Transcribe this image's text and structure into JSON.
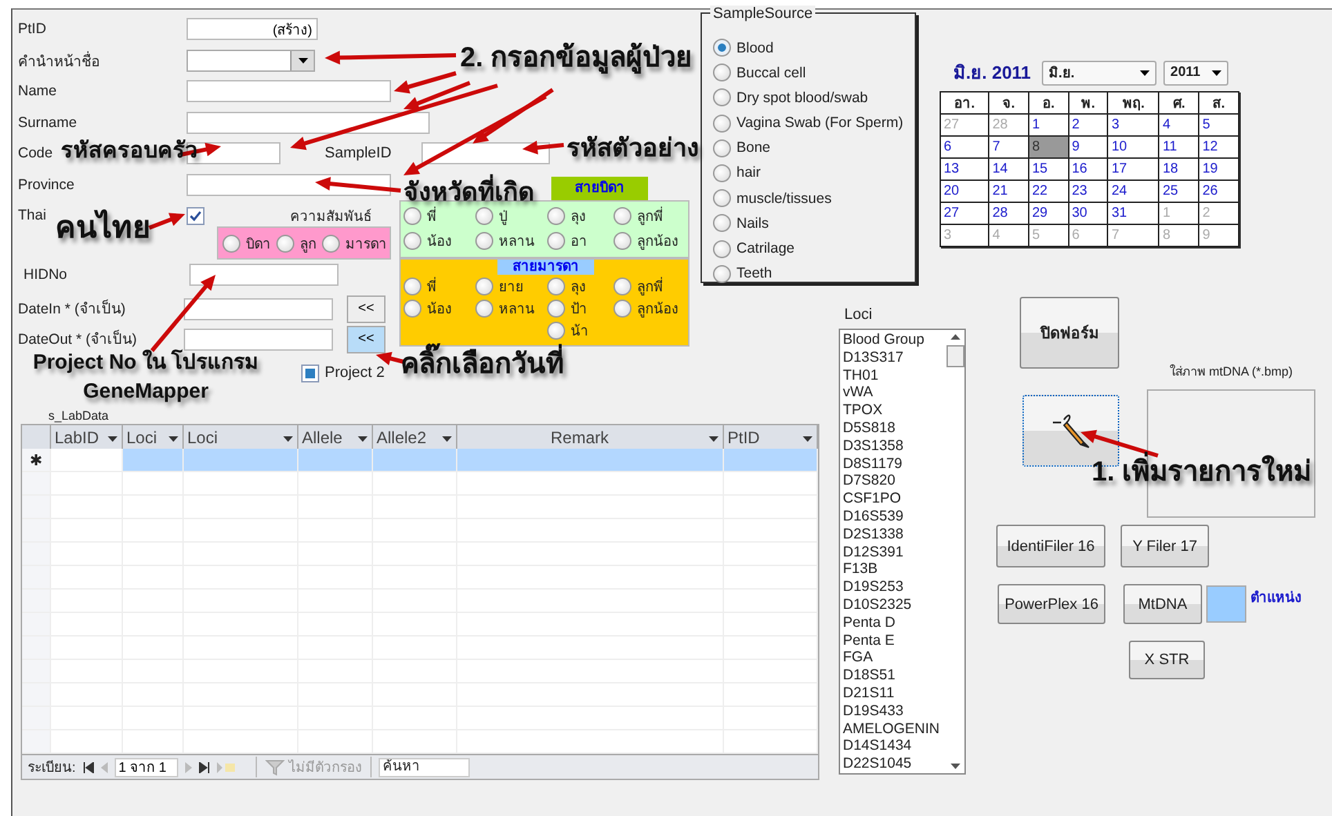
{
  "fields": {
    "ptid": {
      "label": "PtID",
      "value": "(สร้าง)"
    },
    "prefix": {
      "label": "คำนำหน้าชื่อ"
    },
    "name": {
      "label": "Name"
    },
    "surname": {
      "label": "Surname"
    },
    "code": {
      "label": "Code"
    },
    "sample_id": {
      "label": "SampleID"
    },
    "province": {
      "label": "Province"
    },
    "thai": {
      "label": "Thai",
      "checked": true
    },
    "hidno": {
      "label": "HIDNo"
    },
    "date_in": {
      "label": "DateIn * (จำเป็น)",
      "button": "<<"
    },
    "date_out": {
      "label": "DateOut * (จำเป็น)",
      "button": "<<"
    }
  },
  "relationship": {
    "label": "ความสัมพันธ์",
    "options": [
      {
        "label": "บิดา",
        "selected": false
      },
      {
        "label": "ลูก",
        "selected": false
      },
      {
        "label": "มารดา",
        "selected": false
      }
    ]
  },
  "father_line": {
    "title": "สายบิดา",
    "options": [
      {
        "label": "พี่",
        "selected": false
      },
      {
        "label": "ปู่",
        "selected": false
      },
      {
        "label": "ลุง",
        "selected": false
      },
      {
        "label": "ลูกพี่",
        "selected": false
      },
      {
        "label": "น้อง",
        "selected": false
      },
      {
        "label": "หลาน",
        "selected": false
      },
      {
        "label": "อา",
        "selected": false
      },
      {
        "label": "ลูกน้อง",
        "selected": false
      }
    ]
  },
  "mother_line": {
    "title": "สายมารดา",
    "options": [
      {
        "label": "พี่",
        "selected": false
      },
      {
        "label": "ยาย",
        "selected": false
      },
      {
        "label": "ลุง",
        "selected": false
      },
      {
        "label": "ลูกพี่",
        "selected": false
      },
      {
        "label": "น้อง",
        "selected": false
      },
      {
        "label": "หลาน",
        "selected": false
      },
      {
        "label": "ป้า",
        "selected": false
      },
      {
        "label": "ลูกน้อง",
        "selected": false
      },
      {
        "label": "น้า",
        "selected": false
      }
    ]
  },
  "project2": {
    "label": "Project 2",
    "checked": true
  },
  "subform": {
    "label": "s_LabData",
    "columns": [
      "LabID",
      "Loci",
      "Loci",
      "Allele",
      "Allele2",
      "Remark",
      "PtID"
    ],
    "new_row_marker": "✱",
    "navigation": {
      "label": "ระเบียน:",
      "position": "1 จาก 1",
      "filter": "ไม่มีตัวกรอง",
      "search_placeholder": "ค้นหา"
    }
  },
  "sample_source": {
    "title": "SampleSource",
    "options": [
      {
        "label": "Blood",
        "selected": true
      },
      {
        "label": "Buccal cell",
        "selected": false
      },
      {
        "label": "Dry spot blood/swab",
        "selected": false
      },
      {
        "label": "Vagina Swab (For Sperm)",
        "selected": false
      },
      {
        "label": "Bone",
        "selected": false
      },
      {
        "label": "hair",
        "selected": false
      },
      {
        "label": "muscle/tissues",
        "selected": false
      },
      {
        "label": "Nails",
        "selected": false
      },
      {
        "label": "Catrilage",
        "selected": false
      },
      {
        "label": "Teeth",
        "selected": false
      }
    ]
  },
  "calendar": {
    "title": "มิ.ย. 2011",
    "month": "มิ.ย.",
    "year": "2011",
    "weekdays": [
      "อา.",
      "จ.",
      "อ.",
      "พ.",
      "พฤ.",
      "ศ.",
      "ส."
    ],
    "weeks": [
      [
        {
          "day": "27",
          "other_month": true,
          "selected": false
        },
        {
          "day": "28",
          "other_month": true,
          "selected": false
        },
        {
          "day": "1",
          "other_month": false,
          "selected": false
        },
        {
          "day": "2",
          "other_month": false,
          "selected": false
        },
        {
          "day": "3",
          "other_month": false,
          "selected": false
        },
        {
          "day": "4",
          "other_month": false,
          "selected": false
        },
        {
          "day": "5",
          "other_month": false,
          "selected": false
        }
      ],
      [
        {
          "day": "6",
          "other_month": false,
          "selected": false
        },
        {
          "day": "7",
          "other_month": false,
          "selected": false
        },
        {
          "day": "8",
          "other_month": false,
          "selected": true
        },
        {
          "day": "9",
          "other_month": false,
          "selected": false
        },
        {
          "day": "10",
          "other_month": false,
          "selected": false
        },
        {
          "day": "11",
          "other_month": false,
          "selected": false
        },
        {
          "day": "12",
          "other_month": false,
          "selected": false
        }
      ],
      [
        {
          "day": "13",
          "other_month": false,
          "selected": false
        },
        {
          "day": "14",
          "other_month": false,
          "selected": false
        },
        {
          "day": "15",
          "other_month": false,
          "selected": false
        },
        {
          "day": "16",
          "other_month": false,
          "selected": false
        },
        {
          "day": "17",
          "other_month": false,
          "selected": false
        },
        {
          "day": "18",
          "other_month": false,
          "selected": false
        },
        {
          "day": "19",
          "other_month": false,
          "selected": false
        }
      ],
      [
        {
          "day": "20",
          "other_month": false,
          "selected": false
        },
        {
          "day": "21",
          "other_month": false,
          "selected": false
        },
        {
          "day": "22",
          "other_month": false,
          "selected": false
        },
        {
          "day": "23",
          "other_month": false,
          "selected": false
        },
        {
          "day": "24",
          "other_month": false,
          "selected": false
        },
        {
          "day": "25",
          "other_month": false,
          "selected": false
        },
        {
          "day": "26",
          "other_month": false,
          "selected": false
        }
      ],
      [
        {
          "day": "27",
          "other_month": false,
          "selected": false
        },
        {
          "day": "28",
          "other_month": false,
          "selected": false
        },
        {
          "day": "29",
          "other_month": false,
          "selected": false
        },
        {
          "day": "30",
          "other_month": false,
          "selected": false
        },
        {
          "day": "31",
          "other_month": false,
          "selected": false
        },
        {
          "day": "1",
          "other_month": true,
          "selected": false
        },
        {
          "day": "2",
          "other_month": true,
          "selected": false
        }
      ],
      [
        {
          "day": "3",
          "other_month": true,
          "selected": false
        },
        {
          "day": "4",
          "other_month": true,
          "selected": false
        },
        {
          "day": "5",
          "other_month": true,
          "selected": false
        },
        {
          "day": "6",
          "other_month": true,
          "selected": false
        },
        {
          "day": "7",
          "other_month": true,
          "selected": false
        },
        {
          "day": "8",
          "other_month": true,
          "selected": false
        },
        {
          "day": "9",
          "other_month": true,
          "selected": false
        }
      ]
    ]
  },
  "loci": {
    "label": "Loci",
    "items": [
      {
        "label": "Blood Group",
        "selected": false
      },
      {
        "label": "D13S317",
        "selected": false
      },
      {
        "label": "TH01",
        "selected": false
      },
      {
        "label": "vWA",
        "selected": false
      },
      {
        "label": "TPOX",
        "selected": false
      },
      {
        "label": "D5S818",
        "selected": false
      },
      {
        "label": "D3S1358",
        "selected": false
      },
      {
        "label": "D8S1179",
        "selected": false
      },
      {
        "label": "D7S820",
        "selected": false
      },
      {
        "label": "CSF1PO",
        "selected": false
      },
      {
        "label": "D16S539",
        "selected": false
      },
      {
        "label": "D2S1338",
        "selected": false
      },
      {
        "label": "D12S391",
        "selected": false
      },
      {
        "label": "F13B",
        "selected": false
      },
      {
        "label": "D19S253",
        "selected": false
      },
      {
        "label": "D10S2325",
        "selected": false
      },
      {
        "label": "Penta D",
        "selected": false
      },
      {
        "label": "Penta E",
        "selected": false
      },
      {
        "label": "FGA",
        "selected": false
      },
      {
        "label": "D18S51",
        "selected": false
      },
      {
        "label": "D21S11",
        "selected": false
      },
      {
        "label": "D19S433",
        "selected": false
      },
      {
        "label": "AMELOGENIN",
        "selected": false
      },
      {
        "label": "D14S1434",
        "selected": false
      },
      {
        "label": "D22S1045",
        "selected": false
      }
    ]
  },
  "close_button": "ปิดฟอร์ม",
  "picture_label": "ใส่ภาพ mtDNA (*.bmp)",
  "kit_buttons": [
    "IdentiFiler 16",
    "Y Filer 17",
    "PowerPlex 16",
    "MtDNA",
    "X STR"
  ],
  "position_label": "ตำแหน่ง",
  "annotations": [
    "2. กรอกข้อมูลผู้ป่วย",
    "รหัสตัวอย่าง",
    "รหัสครอบครัว",
    "จังหวัดที่เกิด",
    "คนไทย",
    "Project No ใน โปรแกรม GeneMapper",
    "คลิ๊กเลือกวันที่",
    "1. เพิ่มรายการใหม่"
  ]
}
